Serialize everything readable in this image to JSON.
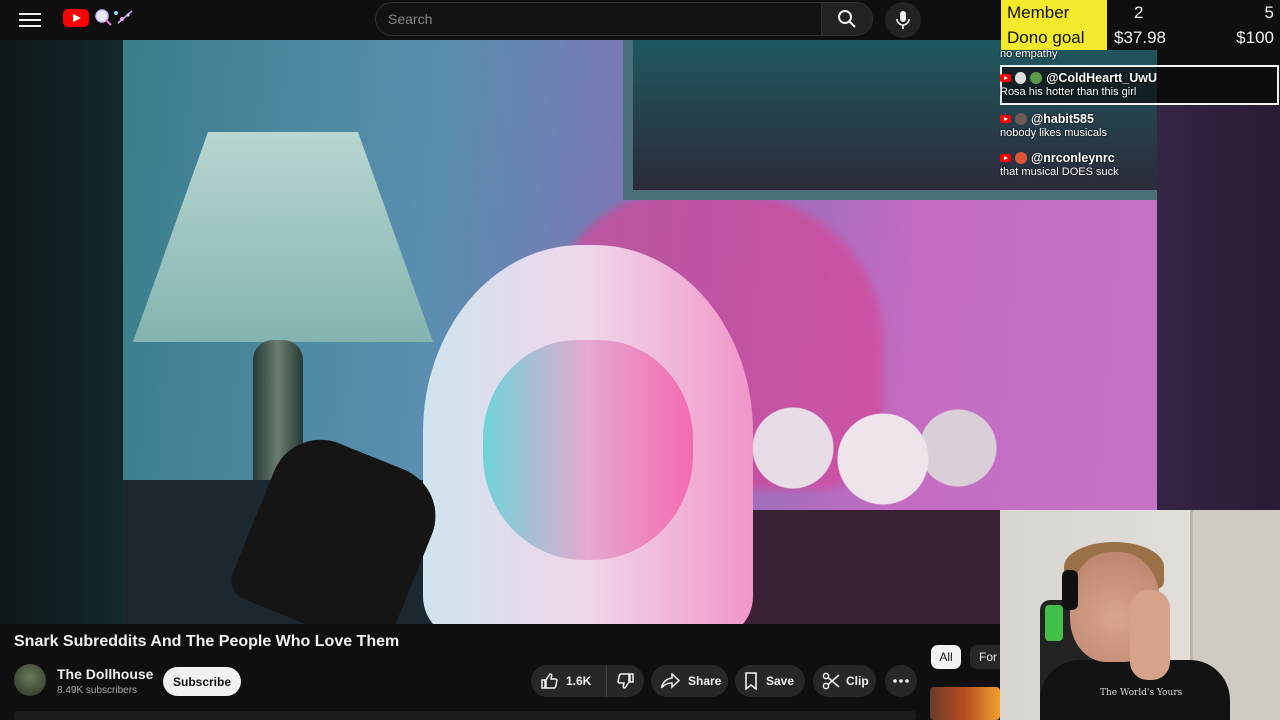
{
  "header": {
    "search_placeholder": "Search"
  },
  "video": {
    "title": "Snark Subreddits And The People Who Love Them",
    "channel_name": "The Dollhouse",
    "subscribers": "8.49K subscribers",
    "subscribe_label": "Subscribe",
    "likes": "1.6K",
    "share_label": "Share",
    "save_label": "Save",
    "clip_label": "Clip"
  },
  "chips": {
    "all": "All",
    "for": "For"
  },
  "overlay": {
    "member_goal_label": "Member Goal",
    "member_goal_current": "2",
    "member_goal_target": "5",
    "dono_goal_label": "Dono goal",
    "dono_goal_current": "$37.98",
    "dono_goal_target": "$100",
    "goal_color": "#f5e92c"
  },
  "chat": {
    "messages": [
      {
        "author": "",
        "text": "no empathy"
      },
      {
        "author": "@ColdHeartt_UwU",
        "text": "Rosa his hotter than this girl"
      },
      {
        "author": "@habit585",
        "text": "nobody likes musicals"
      },
      {
        "author": "@nrconleynrc",
        "text": "that musical DOES suck"
      }
    ]
  },
  "webcam": {
    "shirt_text": "The World's Yours"
  },
  "colors": {
    "accent_red": "#ff0000",
    "background": "#0f0f0f"
  }
}
